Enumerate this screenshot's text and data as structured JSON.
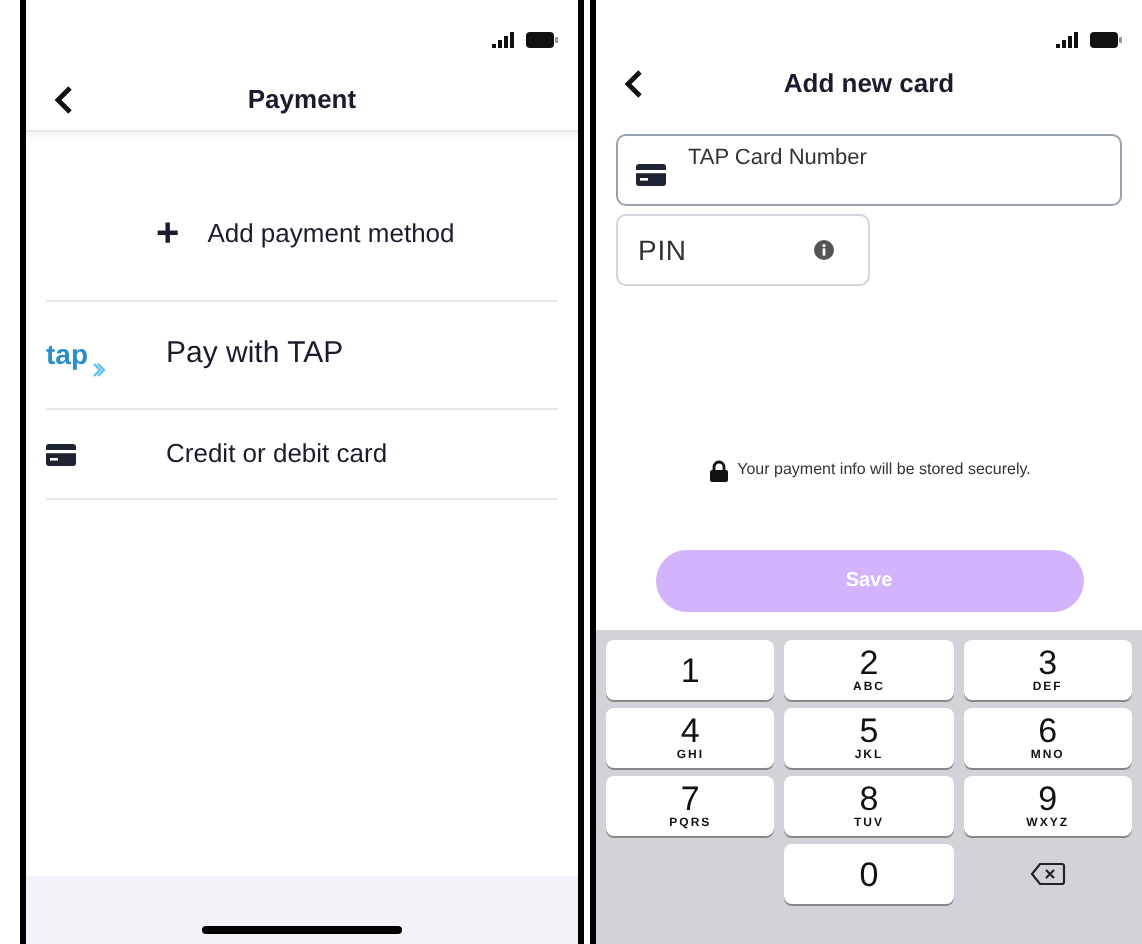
{
  "left_screen": {
    "title": "Payment",
    "add_button": {
      "icon": "+",
      "label": "Add payment method"
    },
    "methods": [
      {
        "kind": "tap",
        "logo": "tap",
        "label": "Pay with TAP"
      },
      {
        "kind": "card",
        "label": "Credit or debit card"
      }
    ]
  },
  "right_screen": {
    "title": "Add new card",
    "card_field": {
      "placeholder": "TAP Card Number"
    },
    "pin_field": {
      "placeholder": "PIN"
    },
    "secure_note": "Your payment info will be stored securely.",
    "save_button": {
      "label": "Save",
      "disabled": true
    },
    "keypad": [
      {
        "kind": "digit",
        "digit": "1"
      },
      {
        "kind": "digit",
        "digit": "2",
        "letters": "ABC"
      },
      {
        "kind": "digit",
        "digit": "3",
        "letters": "DEF"
      },
      {
        "kind": "digit",
        "digit": "4",
        "letters": "GHI"
      },
      {
        "kind": "digit",
        "digit": "5",
        "letters": "JKL"
      },
      {
        "kind": "digit",
        "digit": "6",
        "letters": "MNO"
      },
      {
        "kind": "digit",
        "digit": "7",
        "letters": "PQRS"
      },
      {
        "kind": "digit",
        "digit": "8",
        "letters": "TUV"
      },
      {
        "kind": "digit",
        "digit": "9",
        "letters": "WXYZ"
      },
      {
        "kind": "blank"
      },
      {
        "kind": "digit",
        "digit": "0"
      },
      {
        "kind": "delete"
      }
    ]
  }
}
